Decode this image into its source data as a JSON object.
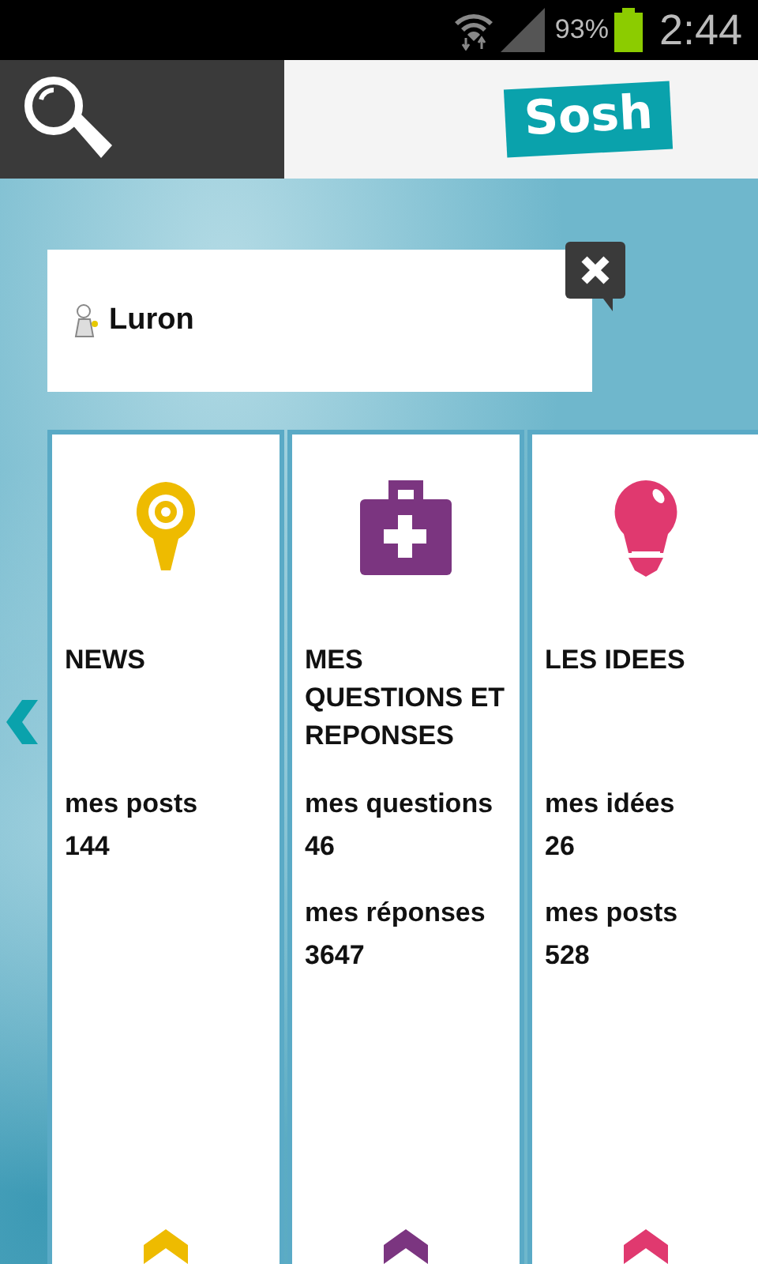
{
  "status_bar": {
    "battery_percent": "93%",
    "time": "2:44"
  },
  "header": {
    "logo": "Sosh"
  },
  "profile": {
    "name": "Luron"
  },
  "cards": [
    {
      "kind": "pin",
      "color": "#eebb00",
      "title": "NEWS",
      "stats": [
        {
          "label": "mes posts",
          "value": "144"
        }
      ]
    },
    {
      "kind": "kit",
      "color": "#7b3580",
      "title": "MES QUESTIONS ET REPONSES",
      "stats": [
        {
          "label": "mes questions",
          "value": "46"
        },
        {
          "label": "mes réponses",
          "value": "3647"
        }
      ]
    },
    {
      "kind": "bulb",
      "color": "#e0396f",
      "title": "LES IDEES",
      "stats": [
        {
          "label": "mes idées",
          "value": "26"
        },
        {
          "label": "mes posts",
          "value": "528"
        }
      ]
    }
  ]
}
